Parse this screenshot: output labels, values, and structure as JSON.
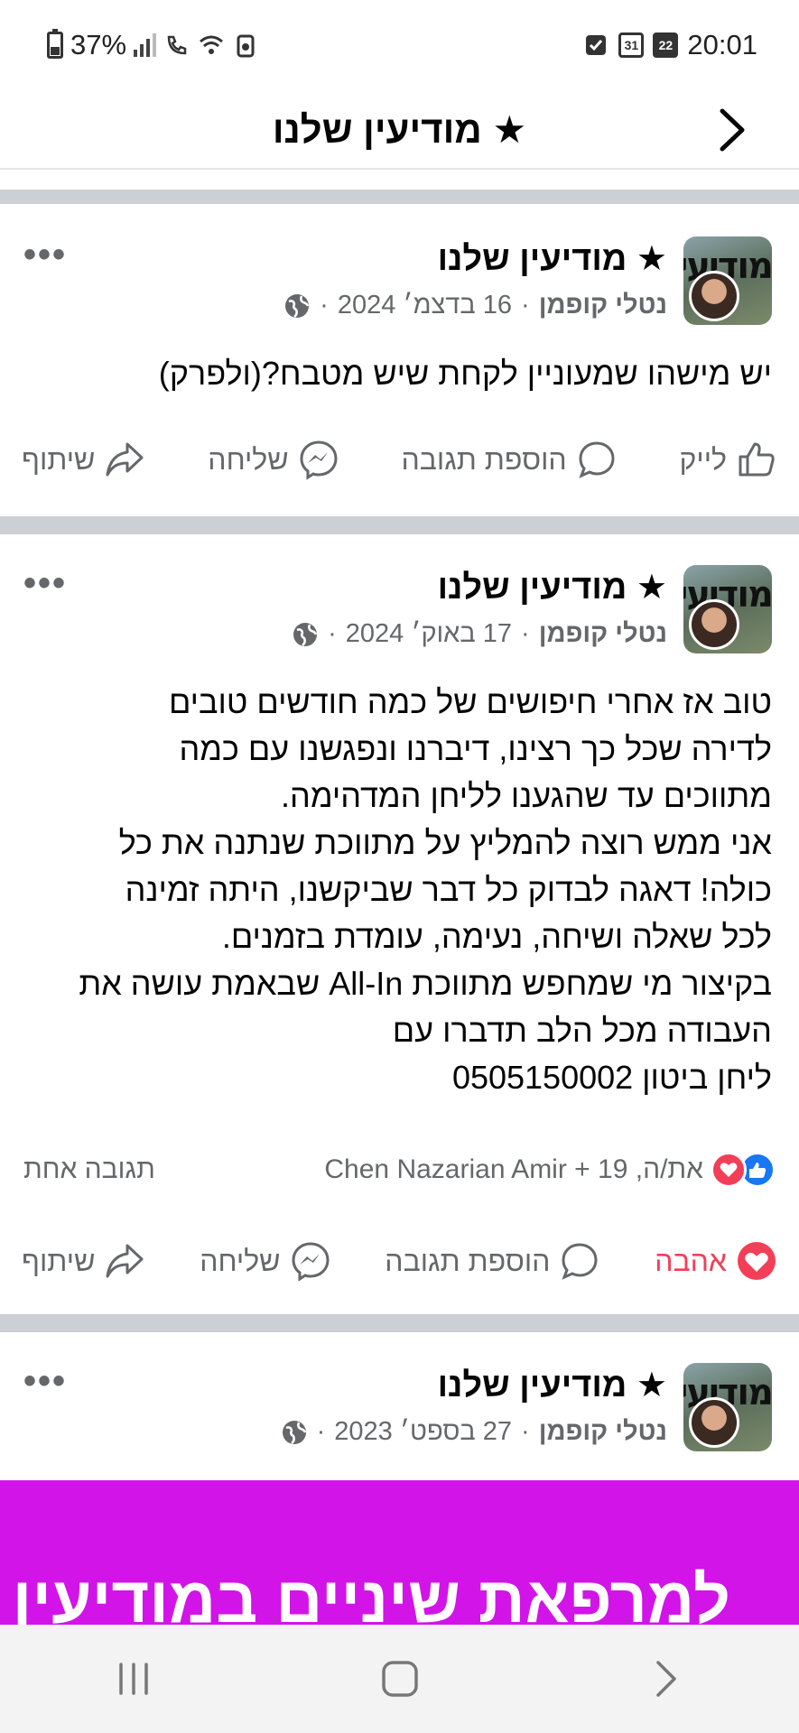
{
  "status_bar": {
    "battery": "37%",
    "time": "20:01",
    "calendar_day_1": "31",
    "calendar_day_2": "22"
  },
  "header": {
    "title": "★ מודיעין שלנו"
  },
  "posts": [
    {
      "group": "★ מודיעין שלנו",
      "author": "נטלי קופמן",
      "date": "16 בדצמ׳ 2024",
      "sep": "·",
      "text": "יש מישהו שמעוניין לקחת שיש מטבח?(ולפרק)",
      "actions": {
        "like": "לייק",
        "comment": "הוספת תגובה",
        "send": "שליחה",
        "share": "שיתוף"
      }
    },
    {
      "group": "★ מודיעין שלנו",
      "author": "נטלי קופמן",
      "date": "17 באוק׳ 2024",
      "sep": "·",
      "text": "טוב אז אחרי חיפושים של כמה חודשים טובים\nלדירה שכל כך רצינו, דיברנו ונפגשנו עם כמה\nמתווכים עד שהגענו לליחן המדהימה.\nאני ממש רוצה להמליץ על מתווכת שנתנה את כל\nכולה! דאגה לבדוק כל דבר שביקשנו, היתה זמינה\nלכל שאלה ושיחה, נעימה, עומדת בזמנים.\nבקיצור מי שמחפש מתווכת All-In שבאמת עושה את\nהעבודה מכל הלב תדברו עם\n ליחן ביטון 0505150002",
      "reactions_text": "את/ה, Chen Nazarian Amir + 19",
      "comments_count": "תגובה אחת",
      "actions": {
        "love": "אהבה",
        "comment": "הוספת תגובה",
        "send": "שליחה",
        "share": "שיתוף"
      }
    },
    {
      "group": "★ מודיעין שלנו",
      "author": "נטלי קופמן",
      "date": "27 בספט׳ 2023",
      "sep": "·",
      "image_text": "למרפאת שיניים במודיעין"
    }
  ],
  "avatar_text": "מודיעין",
  "colors": {
    "divider": "#ccd0d5",
    "secondary_text": "#65676b",
    "love": "#f33e58",
    "like": "#1877f2",
    "image_bg": "#d214e9"
  }
}
